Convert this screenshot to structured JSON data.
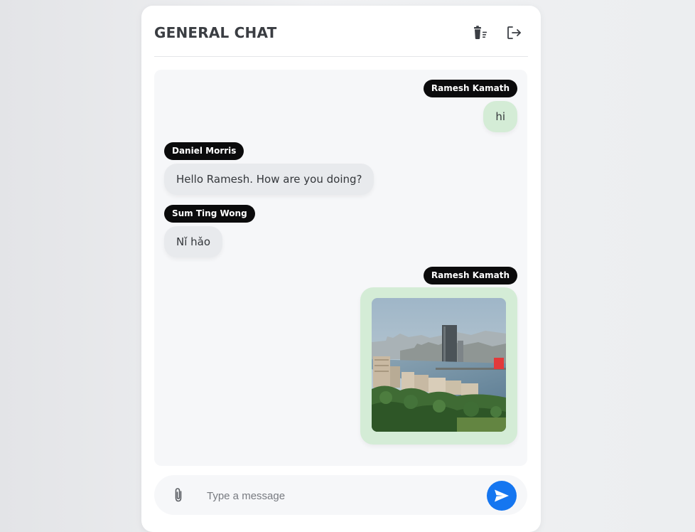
{
  "chat": {
    "title": "GENERAL CHAT",
    "icons": {
      "clear": "trash-filter-icon",
      "logout": "logout-icon",
      "attach": "paperclip-icon",
      "send": "send-icon"
    }
  },
  "messages": [
    {
      "sender": "Ramesh Kamath",
      "text": "hi",
      "direction": "outgoing"
    },
    {
      "sender": "Daniel Morris",
      "text": "Hello Ramesh. How are you doing?",
      "direction": "incoming"
    },
    {
      "sender": "Sum Ting Wong",
      "text": "Nǐ hǎo",
      "direction": "incoming"
    },
    {
      "sender": "Ramesh Kamath",
      "type": "image",
      "direction": "outgoing"
    }
  ],
  "composer": {
    "placeholder": "Type a message",
    "value": ""
  },
  "colors": {
    "outgoing_bubble": "#d4ecd6",
    "incoming_bubble": "#e8eaed",
    "name_tag": "#0b0b0c",
    "send_button": "#1576f0"
  }
}
